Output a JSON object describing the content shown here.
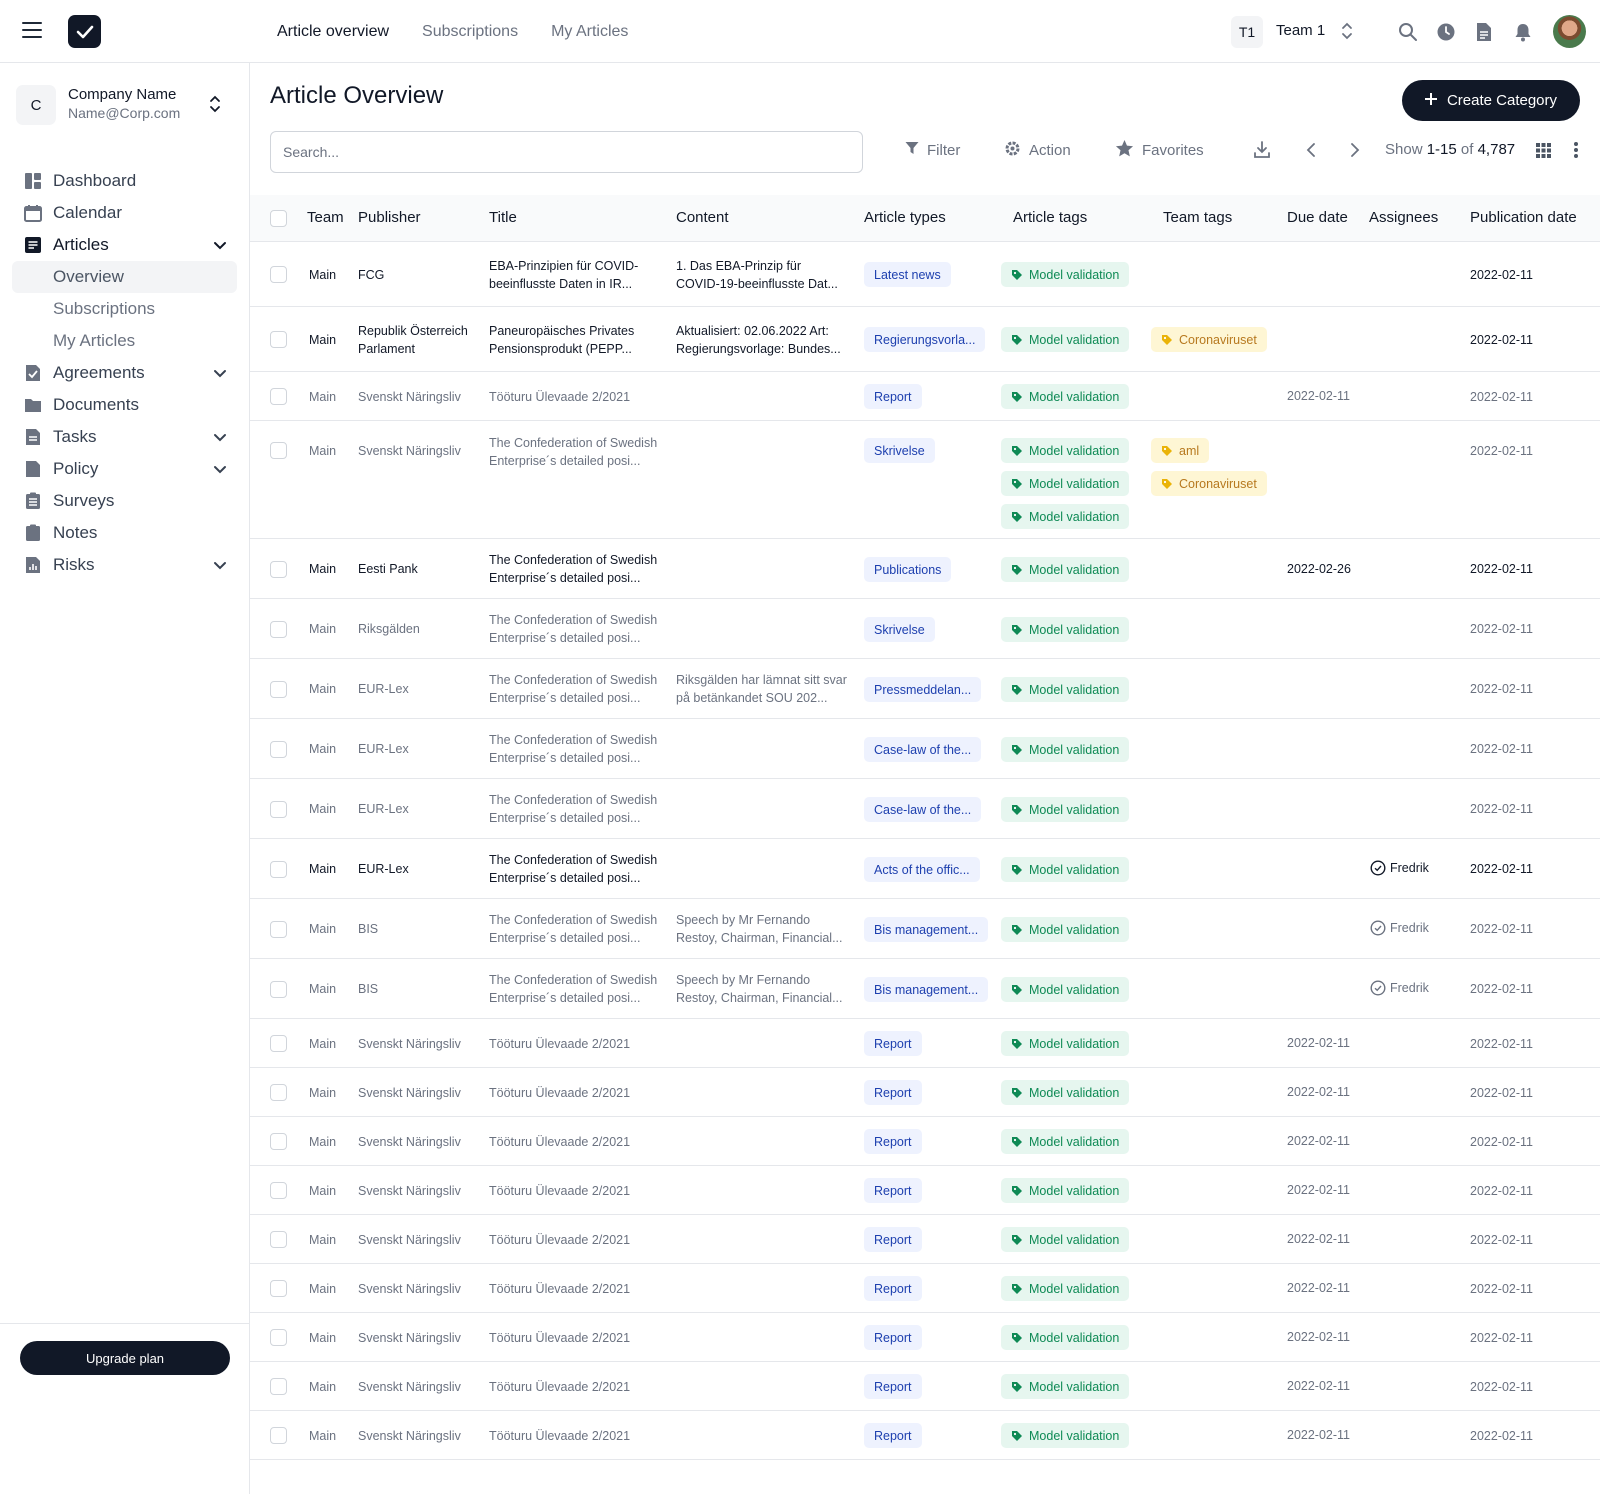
{
  "topnav": {
    "items": [
      {
        "label": "Article overview",
        "active": true
      },
      {
        "label": "Subscriptions",
        "active": false
      },
      {
        "label": "My Articles",
        "active": false
      }
    ],
    "team_short": "T1",
    "team_name": "Team 1"
  },
  "sidebar": {
    "company_initial": "C",
    "company_name": "Company Name",
    "company_email": "Name@Corp.com",
    "items": [
      {
        "label": "Dashboard",
        "icon": "dashboard-icon",
        "chevron": false
      },
      {
        "label": "Calendar",
        "icon": "calendar-icon",
        "chevron": false
      },
      {
        "label": "Articles",
        "icon": "articles-icon",
        "chevron": true,
        "expanded": true,
        "children": [
          {
            "label": "Overview",
            "active": true
          },
          {
            "label": "Subscriptions",
            "active": false
          },
          {
            "label": "My Articles",
            "active": false
          }
        ]
      },
      {
        "label": "Agreements",
        "icon": "agreements-icon",
        "chevron": true
      },
      {
        "label": "Documents",
        "icon": "folder-icon",
        "chevron": false
      },
      {
        "label": "Tasks",
        "icon": "tasks-icon",
        "chevron": true
      },
      {
        "label": "Policy",
        "icon": "policy-icon",
        "chevron": true
      },
      {
        "label": "Surveys",
        "icon": "surveys-icon",
        "chevron": false
      },
      {
        "label": "Notes",
        "icon": "notes-icon",
        "chevron": false
      },
      {
        "label": "Risks",
        "icon": "risks-icon",
        "chevron": true
      }
    ],
    "upgrade_label": "Upgrade plan"
  },
  "main": {
    "title": "Article Overview",
    "create_label": "Create Category",
    "search_placeholder": "Search...",
    "filter_label": "Filter",
    "action_label": "Action",
    "favorites_label": "Favorites",
    "pager": {
      "show": "Show",
      "range": "1-15",
      "of": "of",
      "total": "4,787"
    }
  },
  "table": {
    "headers": [
      "Team",
      "Publisher",
      "Title",
      "Content",
      "Article types",
      "Article tags",
      "Team tags",
      "Due date",
      "Assignees",
      "Publication date"
    ],
    "rows": [
      {
        "muted": false,
        "team": "Main",
        "publisher": [
          "FCG"
        ],
        "title": [
          "EBA-Prinzipien für COVID-",
          "beeinflusste Daten in IR..."
        ],
        "content": [
          "1. Das EBA-Prinzip für",
          "COVID-19-beeinflusste Dat..."
        ],
        "type": "Latest news",
        "tags": [
          "Model validation"
        ],
        "team_tags": [],
        "due": "",
        "assignee": "",
        "pub": "2022-02-11"
      },
      {
        "muted": false,
        "team": "Main",
        "publisher": [
          "Republik Österreich",
          "Parlament"
        ],
        "title": [
          "Paneuropäisches Privates",
          "Pensionsprodukt (PEPP..."
        ],
        "content": [
          "Aktualisiert: 02.06.2022 Art:",
          "Regierungsvorlage: Bundes..."
        ],
        "type": "Regierungsvorla...",
        "tags": [
          "Model validation"
        ],
        "team_tags": [
          "Coronaviruset"
        ],
        "due": "",
        "assignee": "",
        "pub": "2022-02-11"
      },
      {
        "muted": true,
        "team": "Main",
        "publisher": [
          "Svenskt Näringsliv"
        ],
        "title": [
          "Tööturu Ülevaade 2/2021"
        ],
        "content": [],
        "type": "Report",
        "tags": [
          "Model validation"
        ],
        "team_tags": [],
        "due": "2022-02-11",
        "assignee": "",
        "pub": "2022-02-11"
      },
      {
        "muted": true,
        "team": "Main",
        "publisher": [
          "Svenskt Näringsliv"
        ],
        "title": [
          "The Confederation of Swedish",
          "Enterprise´s detailed posi..."
        ],
        "content": [],
        "type": "Skrivelse",
        "tags": [
          "Model validation",
          "Model validation",
          "Model validation"
        ],
        "team_tags": [
          "aml",
          "Coronaviruset"
        ],
        "due": "",
        "assignee": "",
        "pub": "2022-02-11"
      },
      {
        "muted": false,
        "team": "Main",
        "publisher": [
          "Eesti Pank"
        ],
        "title": [
          "The Confederation of Swedish",
          "Enterprise´s detailed posi..."
        ],
        "content": [],
        "type": "Publications",
        "tags": [
          "Model validation"
        ],
        "team_tags": [],
        "due": "2022-02-26",
        "assignee": "",
        "pub": "2022-02-11"
      },
      {
        "muted": true,
        "team": "Main",
        "publisher": [
          "Riksgälden"
        ],
        "title": [
          "The Confederation of Swedish",
          "Enterprise´s detailed posi..."
        ],
        "content": [],
        "type": "Skrivelse",
        "tags": [
          "Model validation"
        ],
        "team_tags": [],
        "due": "",
        "assignee": "",
        "pub": "2022-02-11"
      },
      {
        "muted": true,
        "team": "Main",
        "publisher": [
          "EUR-Lex"
        ],
        "title": [
          "The Confederation of Swedish",
          "Enterprise´s detailed posi..."
        ],
        "content": [
          "Riksgälden har lämnat sitt svar",
          "på betänkandet SOU 202..."
        ],
        "type": "Pressmeddelan...",
        "tags": [
          "Model validation"
        ],
        "team_tags": [],
        "due": "",
        "assignee": "",
        "pub": "2022-02-11"
      },
      {
        "muted": true,
        "team": "Main",
        "publisher": [
          "EUR-Lex"
        ],
        "title": [
          "The Confederation of Swedish",
          "Enterprise´s detailed posi..."
        ],
        "content": [],
        "type": "Case-law of the...",
        "tags": [
          "Model validation"
        ],
        "team_tags": [],
        "due": "",
        "assignee": "",
        "pub": "2022-02-11"
      },
      {
        "muted": true,
        "team": "Main",
        "publisher": [
          "EUR-Lex"
        ],
        "title": [
          "The Confederation of Swedish",
          "Enterprise´s detailed posi..."
        ],
        "content": [],
        "type": "Case-law of the...",
        "tags": [
          "Model validation"
        ],
        "team_tags": [],
        "due": "",
        "assignee": "",
        "pub": "2022-02-11"
      },
      {
        "muted": false,
        "team": "Main",
        "publisher": [
          "EUR-Lex"
        ],
        "title": [
          "The Confederation of Swedish",
          "Enterprise´s detailed posi..."
        ],
        "content": [],
        "type": "Acts of the offic...",
        "tags": [
          "Model validation"
        ],
        "team_tags": [],
        "due": "",
        "assignee": "Fredrik",
        "pub": "2022-02-11"
      },
      {
        "muted": true,
        "team": "Main",
        "publisher": [
          "BIS"
        ],
        "title": [
          "The Confederation of Swedish",
          "Enterprise´s detailed posi..."
        ],
        "content": [
          "Speech by Mr Fernando",
          "Restoy, Chairman, Financial..."
        ],
        "type": "Bis management...",
        "tags": [
          "Model validation"
        ],
        "team_tags": [],
        "due": "",
        "assignee": "Fredrik",
        "pub": "2022-02-11"
      },
      {
        "muted": true,
        "team": "Main",
        "publisher": [
          "BIS"
        ],
        "title": [
          "The Confederation of Swedish",
          "Enterprise´s detailed posi..."
        ],
        "content": [
          "Speech by Mr Fernando",
          "Restoy, Chairman, Financial..."
        ],
        "type": "Bis management...",
        "tags": [
          "Model validation"
        ],
        "team_tags": [],
        "due": "",
        "assignee": "Fredrik",
        "pub": "2022-02-11"
      },
      {
        "muted": true,
        "team": "Main",
        "publisher": [
          "Svenskt Näringsliv"
        ],
        "title": [
          "Tööturu Ülevaade 2/2021"
        ],
        "content": [],
        "type": "Report",
        "tags": [
          "Model validation"
        ],
        "team_tags": [],
        "due": "2022-02-11",
        "assignee": "",
        "pub": "2022-02-11"
      },
      {
        "muted": true,
        "team": "Main",
        "publisher": [
          "Svenskt Näringsliv"
        ],
        "title": [
          "Tööturu Ülevaade 2/2021"
        ],
        "content": [],
        "type": "Report",
        "tags": [
          "Model validation"
        ],
        "team_tags": [],
        "due": "2022-02-11",
        "assignee": "",
        "pub": "2022-02-11"
      },
      {
        "muted": true,
        "team": "Main",
        "publisher": [
          "Svenskt Näringsliv"
        ],
        "title": [
          "Tööturu Ülevaade 2/2021"
        ],
        "content": [],
        "type": "Report",
        "tags": [
          "Model validation"
        ],
        "team_tags": [],
        "due": "2022-02-11",
        "assignee": "",
        "pub": "2022-02-11"
      },
      {
        "muted": true,
        "team": "Main",
        "publisher": [
          "Svenskt Näringsliv"
        ],
        "title": [
          "Tööturu Ülevaade 2/2021"
        ],
        "content": [],
        "type": "Report",
        "tags": [
          "Model validation"
        ],
        "team_tags": [],
        "due": "2022-02-11",
        "assignee": "",
        "pub": "2022-02-11"
      },
      {
        "muted": true,
        "team": "Main",
        "publisher": [
          "Svenskt Näringsliv"
        ],
        "title": [
          "Tööturu Ülevaade 2/2021"
        ],
        "content": [],
        "type": "Report",
        "tags": [
          "Model validation"
        ],
        "team_tags": [],
        "due": "2022-02-11",
        "assignee": "",
        "pub": "2022-02-11"
      },
      {
        "muted": true,
        "team": "Main",
        "publisher": [
          "Svenskt Näringsliv"
        ],
        "title": [
          "Tööturu Ülevaade 2/2021"
        ],
        "content": [],
        "type": "Report",
        "tags": [
          "Model validation"
        ],
        "team_tags": [],
        "due": "2022-02-11",
        "assignee": "",
        "pub": "2022-02-11"
      },
      {
        "muted": true,
        "team": "Main",
        "publisher": [
          "Svenskt Näringsliv"
        ],
        "title": [
          "Tööturu Ülevaade 2/2021"
        ],
        "content": [],
        "type": "Report",
        "tags": [
          "Model validation"
        ],
        "team_tags": [],
        "due": "2022-02-11",
        "assignee": "",
        "pub": "2022-02-11"
      },
      {
        "muted": true,
        "team": "Main",
        "publisher": [
          "Svenskt Näringsliv"
        ],
        "title": [
          "Tööturu Ülevaade 2/2021"
        ],
        "content": [],
        "type": "Report",
        "tags": [
          "Model validation"
        ],
        "team_tags": [],
        "due": "2022-02-11",
        "assignee": "",
        "pub": "2022-02-11"
      },
      {
        "muted": true,
        "team": "Main",
        "publisher": [
          "Svenskt Näringsliv"
        ],
        "title": [
          "Tööturu Ülevaade 2/2021"
        ],
        "content": [],
        "type": "Report",
        "tags": [
          "Model validation"
        ],
        "team_tags": [],
        "due": "2022-02-11",
        "assignee": "",
        "pub": "2022-02-11"
      }
    ]
  },
  "colors": {
    "primary": "#111827",
    "tag_green": "#0e8a55",
    "tag_yellow": "#b7791f",
    "type_blue": "#1e40af"
  }
}
